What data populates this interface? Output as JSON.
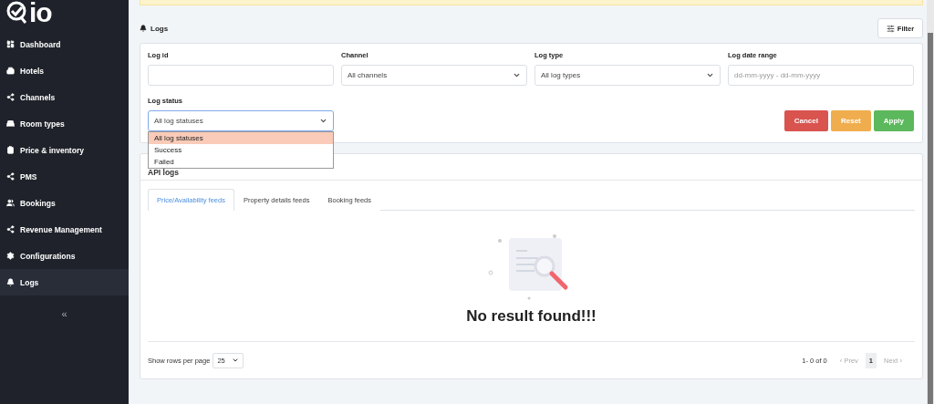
{
  "logo": {
    "text": "io"
  },
  "sidebar": {
    "items": [
      {
        "label": "Dashboard",
        "selected": false
      },
      {
        "label": "Hotels",
        "selected": false
      },
      {
        "label": "Channels",
        "selected": false
      },
      {
        "label": "Room types",
        "selected": false
      },
      {
        "label": "Price & inventory",
        "selected": false
      },
      {
        "label": "PMS",
        "selected": false
      },
      {
        "label": "Bookings",
        "selected": false
      },
      {
        "label": "Revenue Management",
        "selected": false
      },
      {
        "label": "Configurations",
        "selected": false
      },
      {
        "label": "Logs",
        "selected": true
      }
    ],
    "collapse": "«"
  },
  "page_title": "Logs",
  "filter_button": "Filter",
  "filters": {
    "fields": [
      {
        "label": "Log id",
        "kind": "input"
      },
      {
        "label": "Channel",
        "kind": "select",
        "value": "All channels"
      },
      {
        "label": "Log type",
        "kind": "select",
        "value": "All log types"
      },
      {
        "label": "Log date range",
        "kind": "input",
        "placeholder": "dd-mm-yyyy - dd-mm-yyyy"
      },
      {
        "label": "Log status",
        "kind": "select",
        "value": "All log statuses",
        "expanded": true,
        "options": [
          {
            "label": "All log statuses",
            "selected": true
          },
          {
            "label": "Success",
            "selected": false
          },
          {
            "label": "Failed",
            "selected": false
          }
        ]
      }
    ],
    "buttons": [
      {
        "label": "Cancel",
        "color": "#d9534f"
      },
      {
        "label": "Reset",
        "color": "#f0ad4e"
      },
      {
        "label": "Apply",
        "color": "#5cb85c"
      }
    ]
  },
  "api_logs": {
    "title": "API logs",
    "tabs": [
      {
        "label": "Price/Availability feeds",
        "selected": true
      },
      {
        "label": "Property details feeds",
        "selected": false
      },
      {
        "label": "Booking feeds",
        "selected": false
      }
    ],
    "empty_message": "No result found!!!",
    "rows_per_page_label": "Show rows per page",
    "rows_per_page": "25",
    "range": "1- 0 of 0",
    "pager": [
      {
        "label": "‹ Prev",
        "disabled": true,
        "selected": false
      },
      {
        "label": "1",
        "disabled": false,
        "selected": true
      },
      {
        "label": "Next ›",
        "disabled": true,
        "selected": false
      }
    ]
  }
}
